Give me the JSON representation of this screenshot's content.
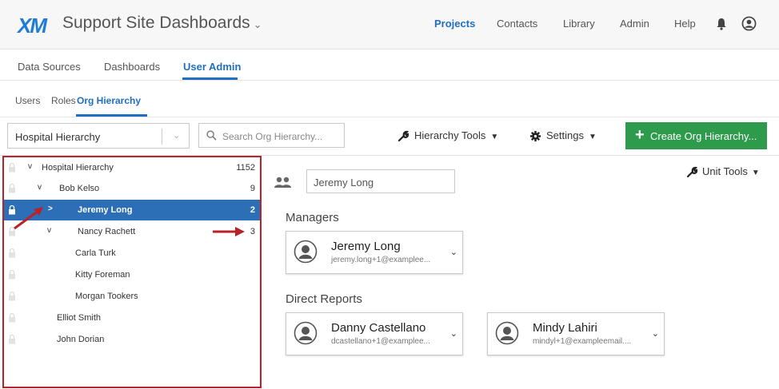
{
  "topbar": {
    "logo": "XM",
    "title": "Support Site Dashboards",
    "nav": [
      "Projects",
      "Contacts",
      "Library",
      "Admin",
      "Help"
    ]
  },
  "tabs_primary": [
    "Data Sources",
    "Dashboards",
    "User Admin"
  ],
  "tabs_secondary": [
    "Users",
    "Roles",
    "Org Hierarchy"
  ],
  "toolbar": {
    "hierarchy_select": "Hospital Hierarchy",
    "search_placeholder": "Search Org Hierarchy...",
    "hierarchy_tools": "Hierarchy Tools",
    "settings": "Settings",
    "create": "Create Org Hierarchy..."
  },
  "tree": [
    {
      "name": "Hospital Hierarchy",
      "count": "1152",
      "caret": "v"
    },
    {
      "name": "Bob Kelso",
      "count": "9",
      "caret": "v"
    },
    {
      "name": "Jeremy Long",
      "count": "2",
      "caret": ">"
    },
    {
      "name": "Nancy Rachett",
      "count": "3",
      "caret": "v"
    },
    {
      "name": "Carla Turk",
      "count": "",
      "caret": ""
    },
    {
      "name": "Kitty Foreman",
      "count": "",
      "caret": ""
    },
    {
      "name": "Morgan Tookers",
      "count": "",
      "caret": ""
    },
    {
      "name": "Elliot Smith",
      "count": "",
      "caret": ""
    },
    {
      "name": "John Dorian",
      "count": "",
      "caret": ""
    }
  ],
  "detail": {
    "unit_name": "Jeremy Long",
    "unit_tools": "Unit Tools",
    "managers_title": "Managers",
    "direct_reports_title": "Direct Reports",
    "managers": [
      {
        "name": "Jeremy Long",
        "email": "jeremy.long+1@examplee..."
      }
    ],
    "direct_reports": [
      {
        "name": "Danny Castellano",
        "email": "dcastellano+1@examplee..."
      },
      {
        "name": "Mindy Lahiri",
        "email": "mindyl+1@exampleemail...."
      }
    ]
  },
  "colors": {
    "accent": "#1f6fc3",
    "selected_row": "#2c6fb7",
    "create_button": "#2d9a4c",
    "annotation": "#b8222a"
  }
}
